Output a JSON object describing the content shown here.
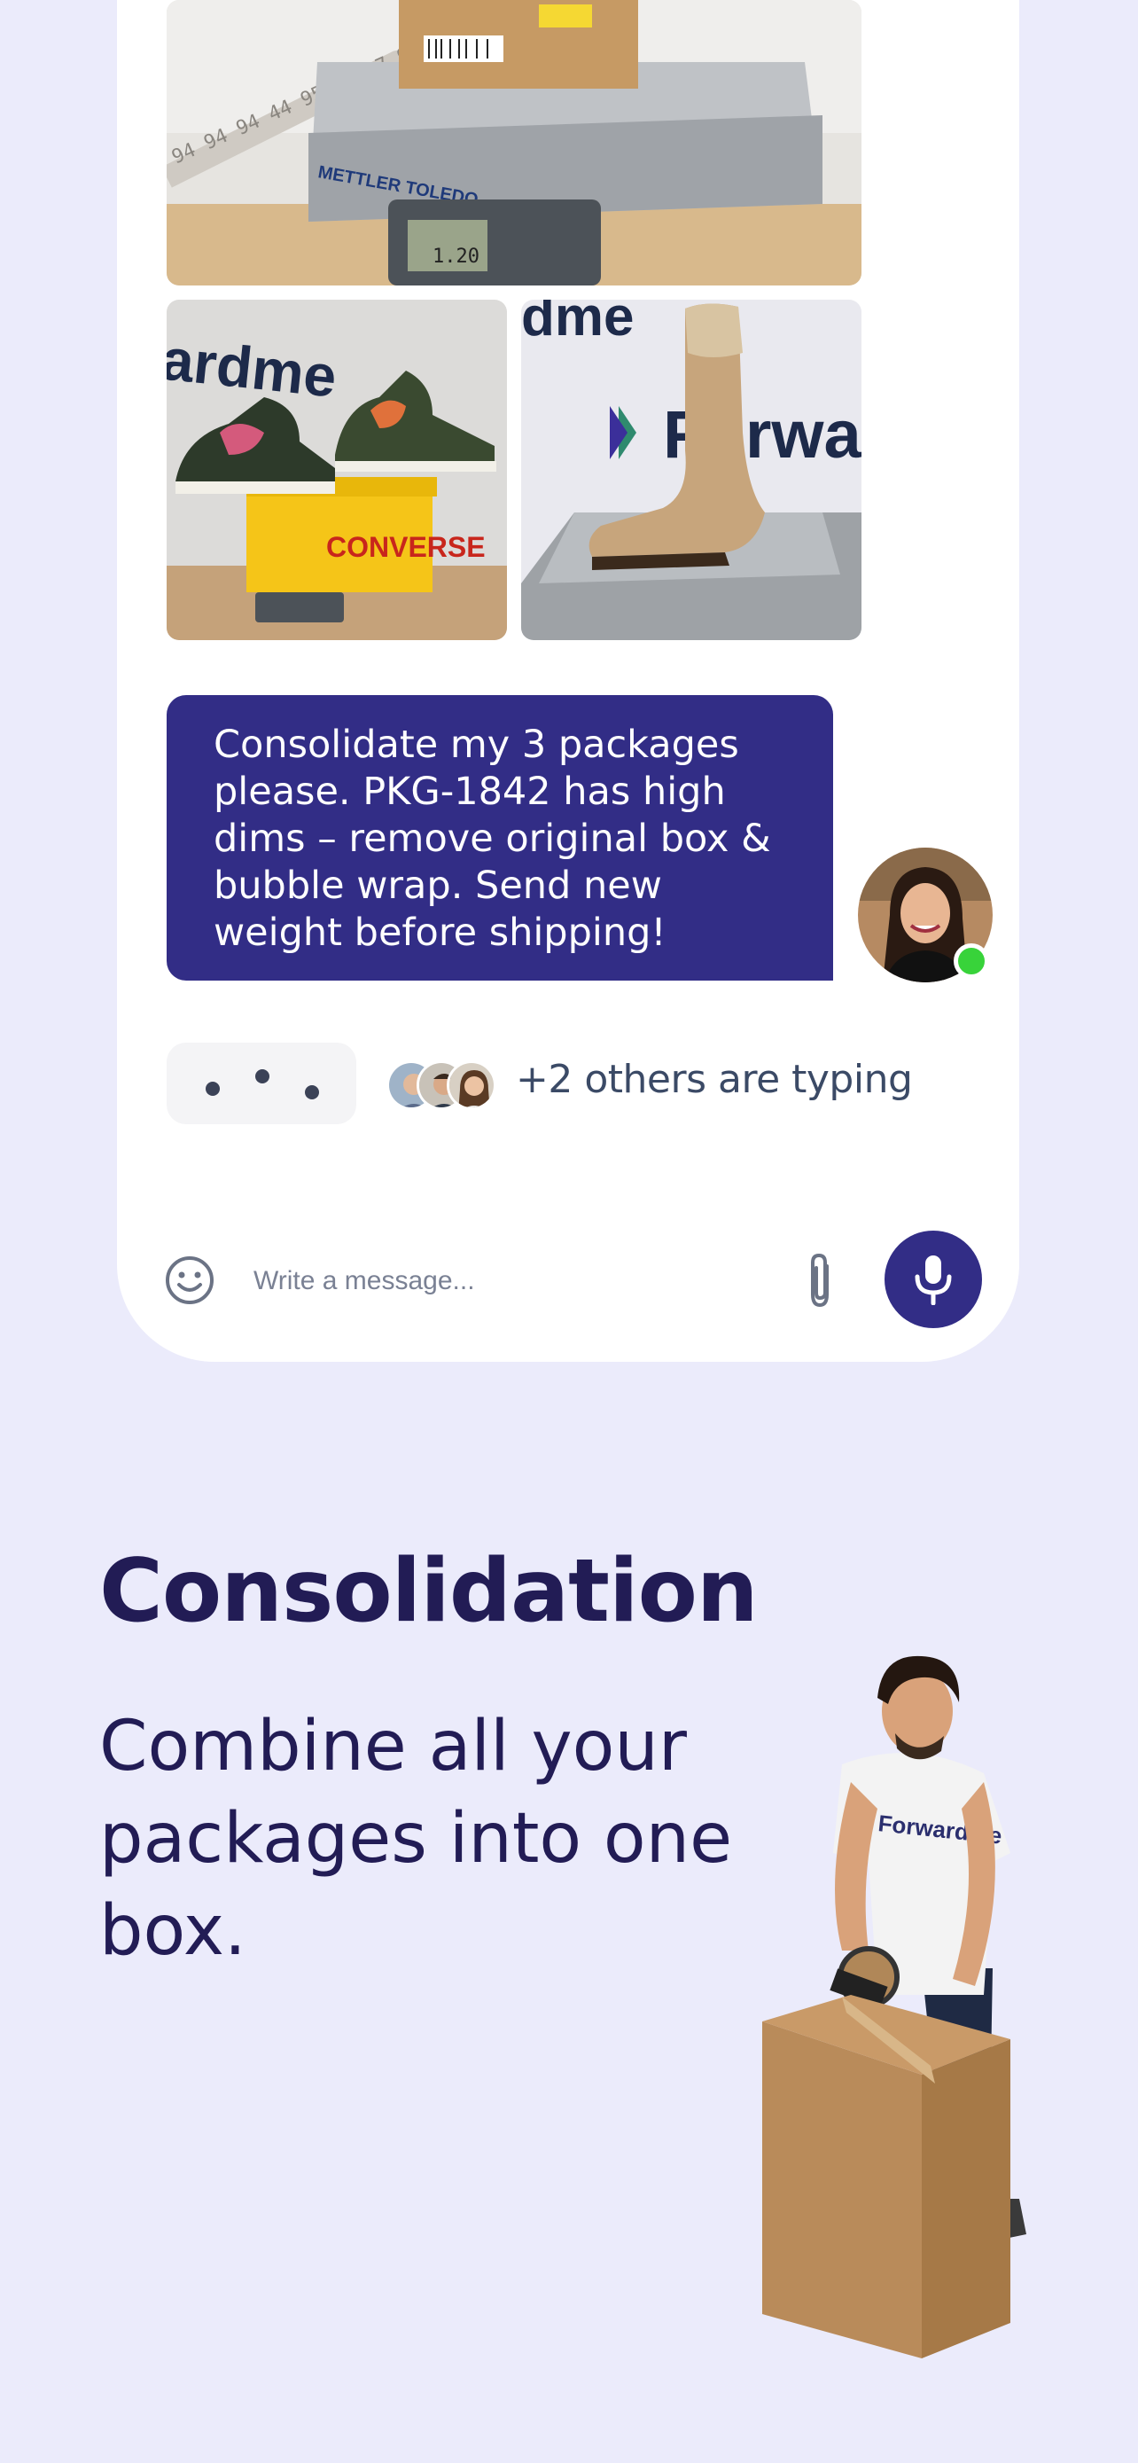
{
  "chat": {
    "message": "Consolidate my 3 packages please. PKG-1842 has high dims – remove original box & bubble wrap. Send new weight before shipping!",
    "typing_text": "+2 others are typing",
    "input_placeholder": "Write a message..."
  },
  "photos": {
    "scale_brand": "METTLER TOLEDO",
    "scale_reading": "1.20",
    "shoebox_brand": "CONVERSE",
    "wall_brand_left": "ardme",
    "wall_brand_right": "Forwar",
    "wall_brand_top": "dme"
  },
  "feature": {
    "title": "Consolidation",
    "subtitle": "Combine all your packages into one box."
  },
  "person": {
    "shirt_text": "Forwardme"
  },
  "colors": {
    "background": "#ebebfb",
    "accent": "#322d86",
    "heading": "#221c55",
    "online": "#38d33a"
  }
}
